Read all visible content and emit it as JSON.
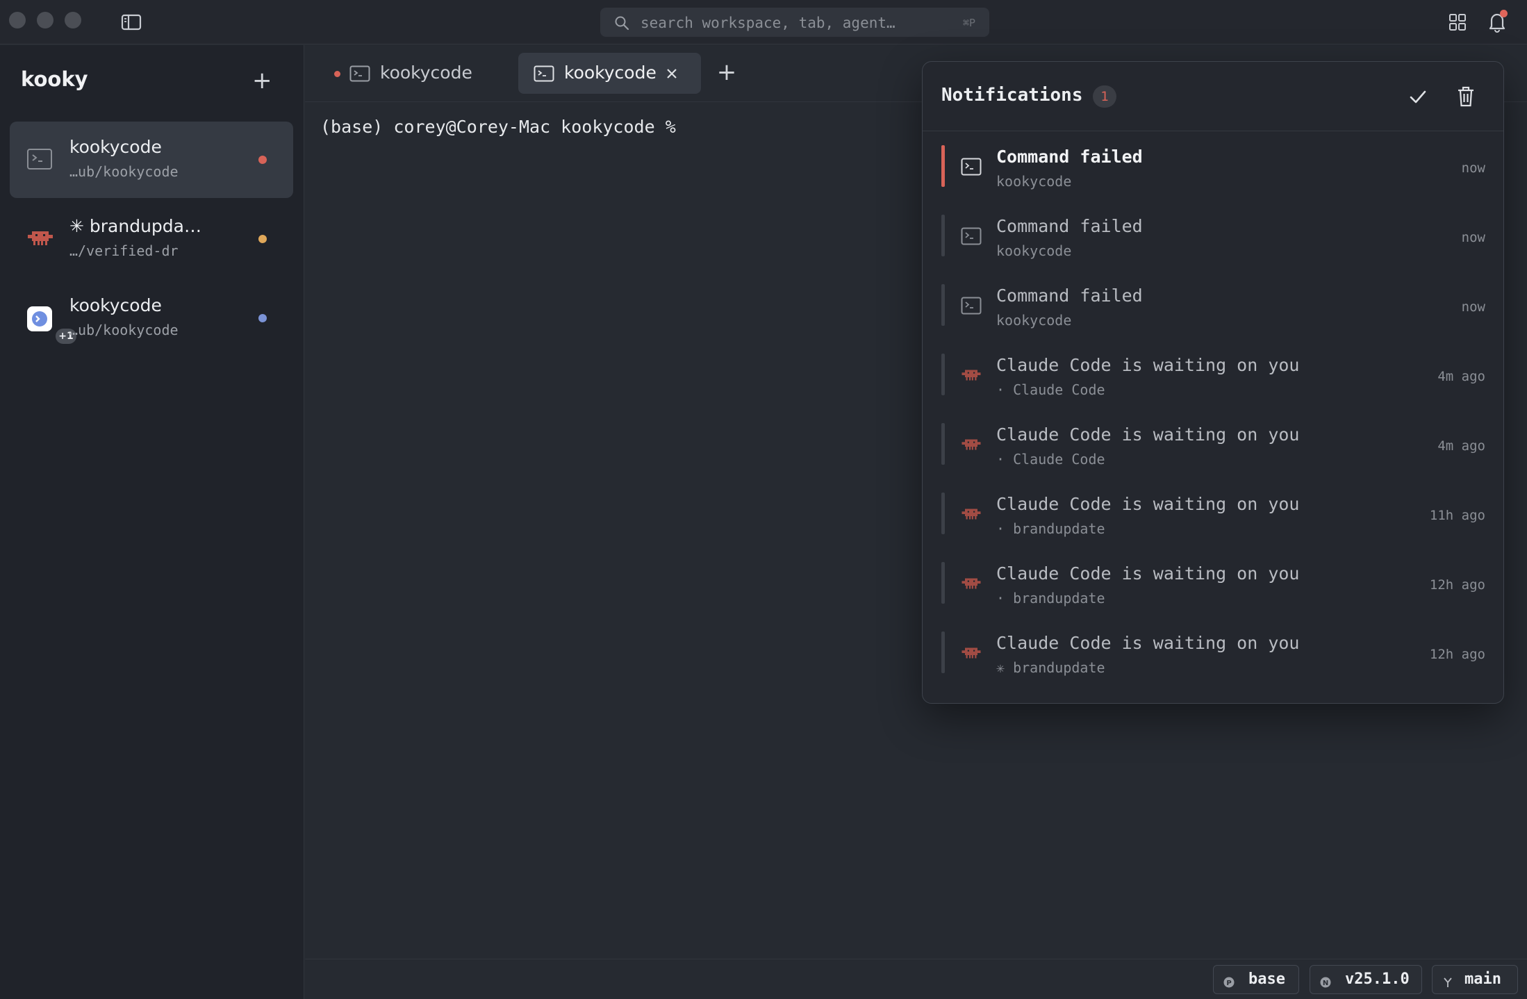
{
  "search": {
    "placeholder": "search workspace, tab, agent…",
    "shortcut": "⌘P"
  },
  "sidebar": {
    "title": "kooky",
    "items": [
      {
        "name": "kookycode",
        "path": "…ub/kookycode",
        "status_color": "#d86358",
        "icon": "terminal-icon"
      },
      {
        "name": "✳ brandupda…",
        "path": "…/verified-dr",
        "status_color": "#e0a85a",
        "icon": "claude-code-icon"
      },
      {
        "name": "kookycode",
        "path": "…ub/kookycode",
        "status_color": "#7b93d6",
        "icon": "app-icon",
        "badge": "+1"
      }
    ]
  },
  "tabs": [
    {
      "label": "kookycode",
      "active": false,
      "unread": true
    },
    {
      "label": "kookycode",
      "active": true,
      "unread": false
    }
  ],
  "terminal": {
    "prompt": "(base) corey@Corey-Mac kookycode %"
  },
  "statusbar": {
    "env": "base",
    "node_version": "v25.1.0",
    "branch": "main"
  },
  "notifications": {
    "title": "Notifications",
    "count": "1",
    "items": [
      {
        "title": "Command failed",
        "subtitle": "kookycode",
        "time": "now",
        "icon": "terminal-icon",
        "unread": true
      },
      {
        "title": "Command failed",
        "subtitle": "kookycode",
        "time": "now",
        "icon": "terminal-icon",
        "unread": false
      },
      {
        "title": "Command failed",
        "subtitle": "kookycode",
        "time": "now",
        "icon": "terminal-icon",
        "unread": false
      },
      {
        "title": "Claude Code is waiting on you",
        "subtitle": "· Claude Code",
        "time": "4m ago",
        "icon": "claude-code-icon",
        "unread": false
      },
      {
        "title": "Claude Code is waiting on you",
        "subtitle": "· Claude Code",
        "time": "4m ago",
        "icon": "claude-code-icon",
        "unread": false
      },
      {
        "title": "Claude Code is waiting on you",
        "subtitle": "· brandupdate",
        "time": "11h ago",
        "icon": "claude-code-icon",
        "unread": false
      },
      {
        "title": "Claude Code is waiting on you",
        "subtitle": "· brandupdate",
        "time": "12h ago",
        "icon": "claude-code-icon",
        "unread": false
      },
      {
        "title": "Claude Code is waiting on you",
        "subtitle": "✳ brandupdate",
        "time": "12h ago",
        "icon": "claude-code-icon",
        "unread": false
      }
    ]
  },
  "colors": {
    "accent_red": "#d86358",
    "accent_yellow": "#e0a85a",
    "accent_blue": "#7b93d6",
    "claude_icon": "#c0574c"
  }
}
